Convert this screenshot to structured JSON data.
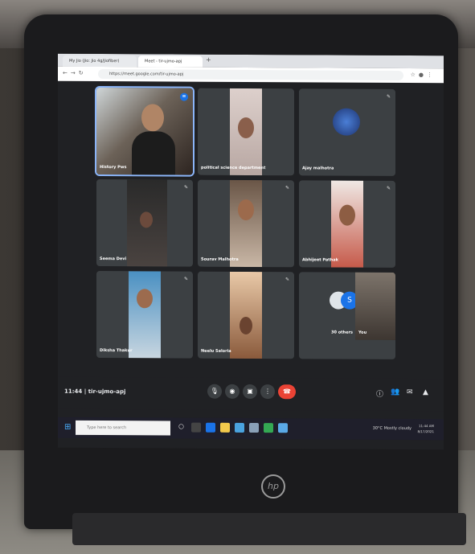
{
  "browser": {
    "tabs": [
      {
        "label": "My Jio (Jio: Jio 4g/Jiofiber)"
      },
      {
        "label": "Meet - tir-ujmo-apj"
      }
    ],
    "url": "https://meet.google.com/tir-ujmo-apj"
  },
  "participants": [
    {
      "name": "History Pws",
      "active": true
    },
    {
      "name": "political science department",
      "active": false
    },
    {
      "name": "Ajay malhotra",
      "active": false
    },
    {
      "name": "Seema Devi",
      "active": false
    },
    {
      "name": "Sourav Malhotra",
      "active": false
    },
    {
      "name": "Abhijeet Pathak",
      "active": false
    },
    {
      "name": "Diksha Thakur",
      "active": false
    },
    {
      "name": "Neelu Saloria",
      "active": false
    },
    {
      "name": "30 others",
      "active": false
    }
  ],
  "others_badge": "S",
  "self_view_label": "You",
  "meeting": {
    "time": "11:44",
    "separator": "|",
    "code": "tir-ujmo-apj"
  },
  "taskbar": {
    "search_placeholder": "Type here to search",
    "weather": "30°C Mostly cloudy",
    "clock_time": "11:44 AM",
    "clock_date": "8/17/2021"
  },
  "brand": "hp"
}
